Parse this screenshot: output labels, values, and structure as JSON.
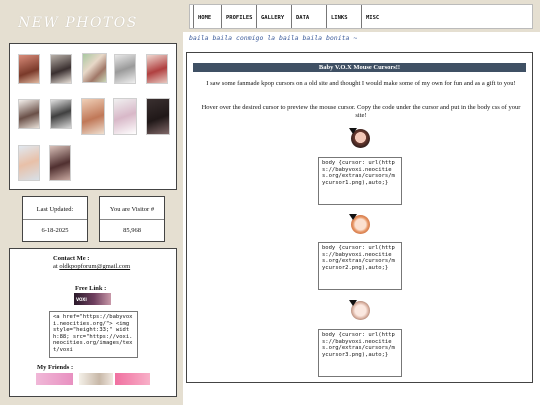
{
  "sidebar": {
    "title": "NEW PHOTOS",
    "stats": {
      "updated_label": "Last Updated:",
      "updated_value": "6-18-2025",
      "visitor_label": "You are Visitor #",
      "visitor_value": "85,968"
    },
    "contact": {
      "title": "Contact Me :",
      "prefix": "at ",
      "email": "oldkpopforum@gmail.com"
    },
    "free_link": {
      "title": "Free Link :",
      "button_text": "VOXI",
      "code": "<a href=\"https://babyvoxi.neocities.org/\"> <img style=\"height:33;\" width:88; src=\"https://voxi.neocities.org/images/text/voxi"
    },
    "friends_title": "My Friends :"
  },
  "nav": {
    "items": [
      "HOME",
      "PROFILES",
      "GALLERY",
      "DATA",
      "LINKS",
      "MISC"
    ]
  },
  "tagline": "baila baila conmigo la baila baila bonita ~",
  "content": {
    "banner": "Baby V.O.X Mouse Cursors!!",
    "intro": "I saw some fanmade kpop cursors on a old site and thought I would make some of my own for fun and as a gift to you!",
    "instructions": "Hover over the desired cursor to preview the mouse cursor. Copy the code under the cursor and put in the body css of your site!",
    "cursors": [
      {
        "code": "body {cursor: url(https://babyvoxi.neocities.org/extras/cursors/mycursor1.png),auto;}"
      },
      {
        "code": "body {cursor: url(https://babyvoxi.neocities.org/extras/cursors/mycursor2.png),auto;}"
      },
      {
        "code": "body {cursor: url(https://babyvoxi.neocities.org/extras/cursors/mycursor3.png),auto;}"
      }
    ]
  }
}
